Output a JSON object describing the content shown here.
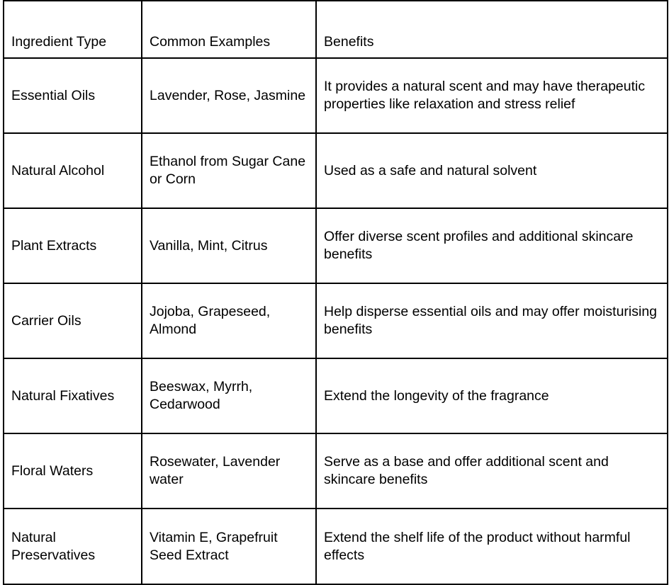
{
  "table": {
    "headers": [
      "Ingredient Type",
      "Common Examples",
      "Benefits"
    ],
    "rows": [
      {
        "type": "Essential Oils",
        "examples": "Lavender, Rose, Jasmine",
        "benefits": "It provides a natural scent and may have therapeutic properties like relaxation and stress relief"
      },
      {
        "type": "Natural Alcohol",
        "examples": "Ethanol from Sugar Cane or Corn",
        "benefits": "Used as a safe and natural solvent"
      },
      {
        "type": "Plant Extracts",
        "examples": "Vanilla, Mint, Citrus",
        "benefits": "Offer diverse scent profiles and additional skincare benefits"
      },
      {
        "type": "Carrier Oils",
        "examples": "Jojoba, Grapeseed, Almond",
        "benefits": "Help disperse essential oils and may offer moisturising benefits"
      },
      {
        "type": "Natural Fixatives",
        "examples": "Beeswax, Myrrh, Cedarwood",
        "benefits": "Extend the longevity of the fragrance"
      },
      {
        "type": "Floral Waters",
        "examples": "Rosewater, Lavender water",
        "benefits": "Serve as a base and offer additional scent and skincare benefits"
      },
      {
        "type": "Natural Preservatives",
        "examples": "Vitamin E, Grapefruit Seed Extract",
        "benefits": "Extend the shelf life of the product without harmful effects"
      }
    ]
  }
}
